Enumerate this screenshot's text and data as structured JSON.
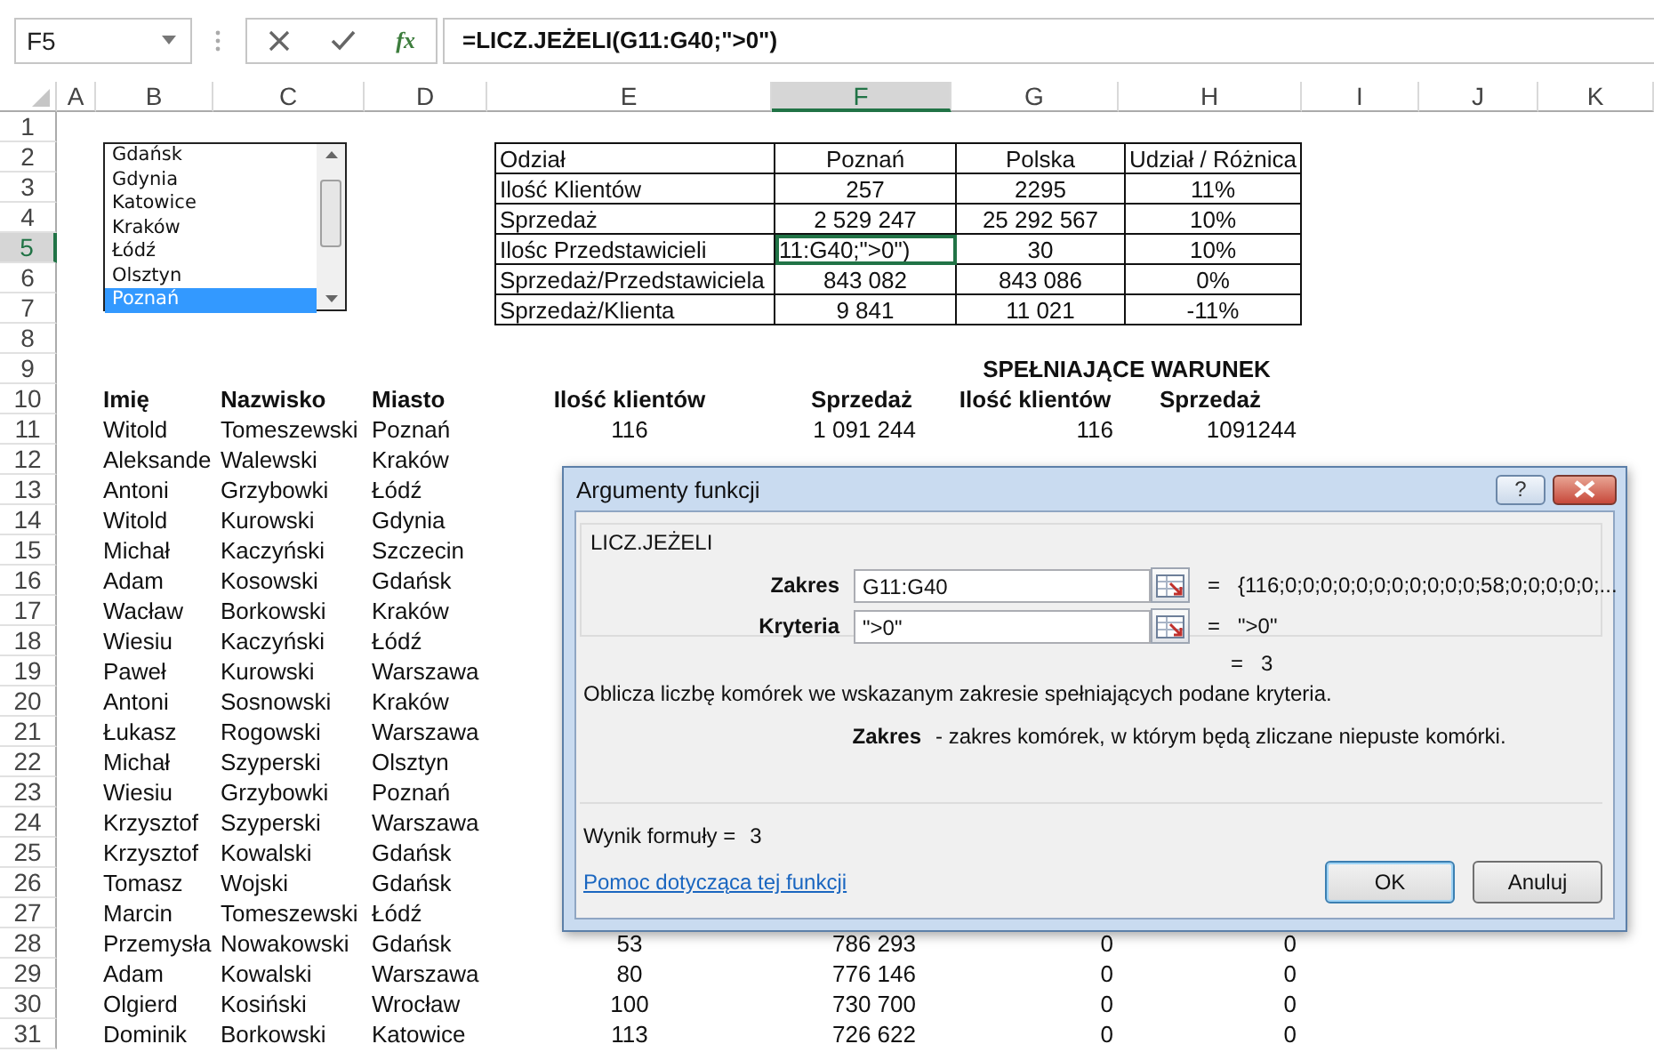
{
  "formula_bar": {
    "name_box": "F5",
    "function_button": "fx",
    "formula": "=LICZ.JEŻELI(G11:G40;\">0\")"
  },
  "column_headers": [
    {
      "label": "A",
      "selected": false
    },
    {
      "label": "B",
      "selected": false
    },
    {
      "label": "C",
      "selected": false
    },
    {
      "label": "D",
      "selected": false
    },
    {
      "label": "E",
      "selected": false
    },
    {
      "label": "F",
      "selected": true
    },
    {
      "label": "G",
      "selected": false
    },
    {
      "label": "H",
      "selected": false
    },
    {
      "label": "I",
      "selected": false
    },
    {
      "label": "J",
      "selected": false
    },
    {
      "label": "K",
      "selected": false
    }
  ],
  "row_headers": [
    {
      "label": "1",
      "selected": false
    },
    {
      "label": "2",
      "selected": false
    },
    {
      "label": "3",
      "selected": false
    },
    {
      "label": "4",
      "selected": false
    },
    {
      "label": "5",
      "selected": true
    },
    {
      "label": "6",
      "selected": false
    },
    {
      "label": "7",
      "selected": false
    },
    {
      "label": "8",
      "selected": false
    },
    {
      "label": "9",
      "selected": false
    },
    {
      "label": "10",
      "selected": false
    },
    {
      "label": "11",
      "selected": false
    },
    {
      "label": "12",
      "selected": false
    },
    {
      "label": "13",
      "selected": false
    },
    {
      "label": "14",
      "selected": false
    },
    {
      "label": "15",
      "selected": false
    },
    {
      "label": "16",
      "selected": false
    },
    {
      "label": "17",
      "selected": false
    },
    {
      "label": "18",
      "selected": false
    },
    {
      "label": "19",
      "selected": false
    },
    {
      "label": "20",
      "selected": false
    },
    {
      "label": "21",
      "selected": false
    },
    {
      "label": "22",
      "selected": false
    },
    {
      "label": "23",
      "selected": false
    },
    {
      "label": "24",
      "selected": false
    },
    {
      "label": "25",
      "selected": false
    },
    {
      "label": "26",
      "selected": false
    },
    {
      "label": "27",
      "selected": false
    },
    {
      "label": "28",
      "selected": false
    },
    {
      "label": "29",
      "selected": false
    },
    {
      "label": "30",
      "selected": false
    },
    {
      "label": "31",
      "selected": false
    }
  ],
  "city_listbox": {
    "items": [
      {
        "label": "Gdańsk",
        "selected": false
      },
      {
        "label": "Gdynia",
        "selected": false
      },
      {
        "label": "Katowice",
        "selected": false
      },
      {
        "label": "Kraków",
        "selected": false
      },
      {
        "label": "Łódź",
        "selected": false
      },
      {
        "label": "Olsztyn",
        "selected": false
      },
      {
        "label": "Poznań",
        "selected": true
      }
    ]
  },
  "summary_table": {
    "rows": [
      {
        "cells": [
          {
            "text": "Odział",
            "editing": false
          },
          {
            "text": "Poznań",
            "editing": false
          },
          {
            "text": "Polska",
            "editing": false
          },
          {
            "text": "Udział / Różnica",
            "editing": false
          }
        ]
      },
      {
        "cells": [
          {
            "text": "Ilość Klientów",
            "editing": false
          },
          {
            "text": "257",
            "editing": false
          },
          {
            "text": "2295",
            "editing": false
          },
          {
            "text": "11%",
            "editing": false
          }
        ]
      },
      {
        "cells": [
          {
            "text": "Sprzedaż",
            "editing": false
          },
          {
            "text": "2 529 247",
            "editing": false
          },
          {
            "text": "25 292 567",
            "editing": false
          },
          {
            "text": "10%",
            "editing": false
          }
        ]
      },
      {
        "cells": [
          {
            "text": "Ilośc Przedstawicieli",
            "editing": false
          },
          {
            "text": "11:G40;\">0\")",
            "editing": true
          },
          {
            "text": "30",
            "editing": false
          },
          {
            "text": "10%",
            "editing": false
          }
        ]
      },
      {
        "cells": [
          {
            "text": "Sprzedaż/Przedstawiciela",
            "editing": false
          },
          {
            "text": "843 082",
            "editing": false
          },
          {
            "text": "843 086",
            "editing": false
          },
          {
            "text": "0%",
            "editing": false
          }
        ]
      },
      {
        "cells": [
          {
            "text": "Sprzedaż/Klienta",
            "editing": false
          },
          {
            "text": "9 841",
            "editing": false
          },
          {
            "text": "11 021",
            "editing": false
          },
          {
            "text": "-11%",
            "editing": false
          }
        ]
      }
    ]
  },
  "clients_table": {
    "section_title": "SPEŁNIAJĄCE WARUNEK",
    "columns": [
      "Imię",
      "Nazwisko",
      "Miasto",
      "Ilość klientów",
      "Sprzedaż",
      "Ilość klientów",
      "Sprzedaż"
    ],
    "rows": [
      [
        "Witold",
        "Tomeszewski",
        "Poznań",
        "116",
        "1 091 244",
        "116",
        "1091244"
      ],
      [
        "Aleksande",
        "Walewski",
        "Kraków"
      ],
      [
        "Antoni",
        "Grzybowki",
        "Łódź"
      ],
      [
        "Witold",
        "Kurowski",
        "Gdynia"
      ],
      [
        "Michał",
        "Kaczyński",
        "Szczecin"
      ],
      [
        "Adam",
        "Kosowski",
        "Gdańsk"
      ],
      [
        "Wacław",
        "Borkowski",
        "Kraków"
      ],
      [
        "Wiesiu",
        "Kaczyński",
        "Łódź"
      ],
      [
        "Paweł",
        "Kurowski",
        "Warszawa"
      ],
      [
        "Antoni",
        "Sosnowski",
        "Kraków"
      ],
      [
        "Łukasz",
        "Rogowski",
        "Warszawa"
      ],
      [
        "Michał",
        "Szyperski",
        "Olsztyn"
      ],
      [
        "Wiesiu",
        "Grzybowki",
        "Poznań"
      ],
      [
        "Krzysztof",
        "Szyperski",
        "Warszawa"
      ],
      [
        "Krzysztof",
        "Kowalski",
        "Gdańsk"
      ],
      [
        "Tomasz",
        "Wojski",
        "Gdańsk"
      ],
      [
        "Marcin",
        "Tomeszewski",
        "Łódź"
      ],
      [
        "Przemysła",
        "Nowakowski",
        "Gdańsk",
        "53",
        "786 293",
        "0",
        "0"
      ],
      [
        "Adam",
        "Kowalski",
        "Warszawa",
        "80",
        "776 146",
        "0",
        "0"
      ],
      [
        "Olgierd",
        "Kosiński",
        "Wrocław",
        "100",
        "730 700",
        "0",
        "0"
      ],
      [
        "Dominik",
        "Borkowski",
        "Katowice",
        "113",
        "726 622",
        "0",
        "0"
      ]
    ]
  },
  "dialog": {
    "title": "Argumenty funkcji",
    "help_button": "?",
    "function_name": "LICZ.JEŻELI",
    "arguments": [
      {
        "label": "Zakres",
        "value": "G11:G40",
        "equals": "=",
        "result": "{116;0;0;0;0;0;0;0;0;0;0;0;58;0;0;0;0;0;..."
      },
      {
        "label": "Kryteria",
        "value": "\">0\"",
        "equals": "=",
        "result": "\">0\""
      }
    ],
    "result": {
      "equals": "=",
      "value": "3"
    },
    "description": "Oblicza liczbę komórek we wskazanym zakresie spełniających podane kryteria.",
    "argument_help": {
      "label": "Zakres",
      "text": "- zakres komórek, w którym będą zliczane niepuste komórki."
    },
    "formula_result": {
      "label": "Wynik formuły =",
      "value": "3"
    },
    "help_link": "Pomoc dotycząca tej funkcji",
    "buttons": [
      {
        "label": "OK",
        "default": true
      },
      {
        "label": "Anuluj",
        "default": false
      }
    ]
  }
}
